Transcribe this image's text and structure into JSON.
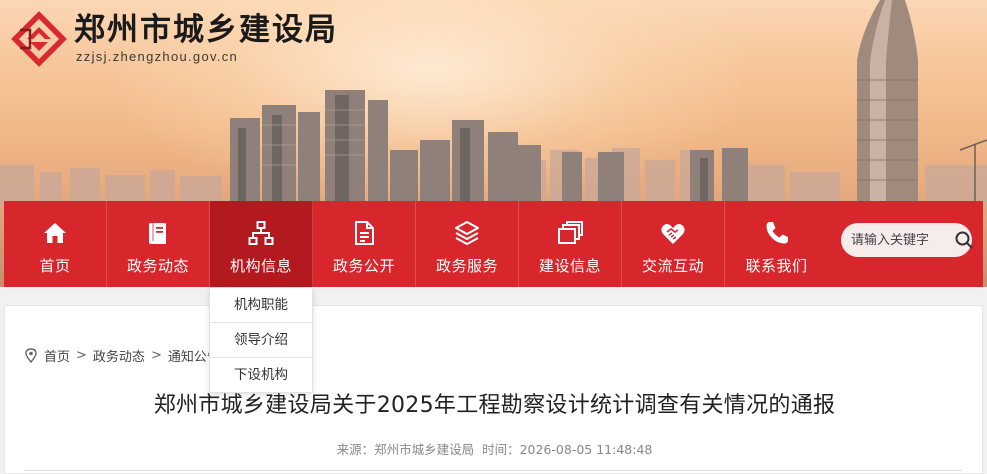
{
  "site": {
    "name": "郑州市城乡建设局",
    "url": "zzjsj.zhengzhou.gov.cn"
  },
  "nav": {
    "items": [
      {
        "label": "首页",
        "icon": "home-icon"
      },
      {
        "label": "政务动态",
        "icon": "book-icon"
      },
      {
        "label": "机构信息",
        "icon": "org-chart-icon"
      },
      {
        "label": "政务公开",
        "icon": "document-icon"
      },
      {
        "label": "政务服务",
        "icon": "layers-icon"
      },
      {
        "label": "建设信息",
        "icon": "stack-icon"
      },
      {
        "label": "交流互动",
        "icon": "handshake-heart-icon"
      },
      {
        "label": "联系我们",
        "icon": "phone-icon"
      }
    ],
    "active_index": 2,
    "search_placeholder": "请输入关键字"
  },
  "dropdown": {
    "items": [
      "机构职能",
      "领导介绍",
      "下设机构"
    ]
  },
  "breadcrumb": {
    "items": [
      "首页",
      "政务动态",
      "通知公告"
    ]
  },
  "article": {
    "title": "郑州市城乡建设局关于2025年工程勘察设计统计调查有关情况的通报",
    "source_label": "来源：",
    "source": "郑州市城乡建设局",
    "time_label": "时间：",
    "time": "2026-08-05 11:48:48"
  },
  "colors": {
    "nav_red": "#d7262c",
    "nav_active": "#b21a20",
    "logo_red": "#d9282f"
  }
}
